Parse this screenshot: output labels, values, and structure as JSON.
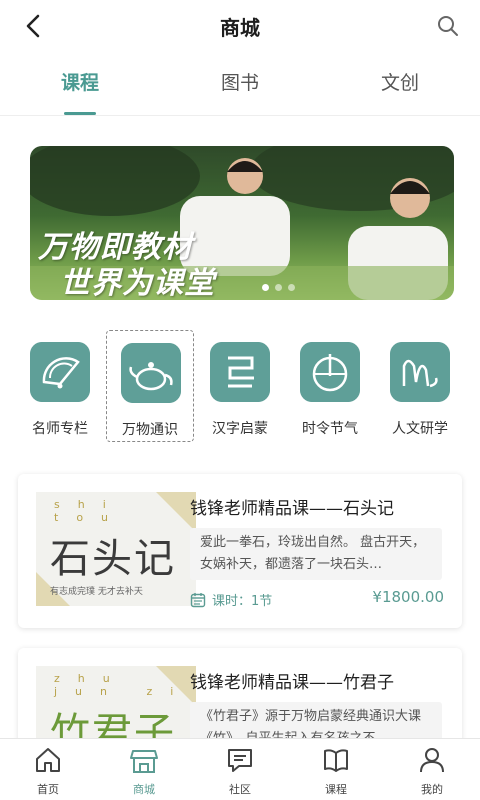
{
  "header": {
    "title": "商城",
    "back_icon": "back-arrow-icon",
    "search_icon": "search-icon"
  },
  "tabs": [
    {
      "label": "课程",
      "active": true
    },
    {
      "label": "图书",
      "active": false
    },
    {
      "label": "文创",
      "active": false
    }
  ],
  "banner": {
    "line1": "万物即教材",
    "line2": "世界为课堂",
    "slide_count": 3,
    "active_slide": 0
  },
  "categories": [
    {
      "label": "名师专栏",
      "icon": "fan-icon"
    },
    {
      "label": "万物通识",
      "icon": "teapot-icon"
    },
    {
      "label": "汉字启蒙",
      "icon": "character-icon"
    },
    {
      "label": "时令节气",
      "icon": "sundial-icon"
    },
    {
      "label": "人文研学",
      "icon": "mountain-icon"
    }
  ],
  "courses": [
    {
      "cover_pinyin": "shi  tou",
      "cover_title": "石头记",
      "cover_sub": "有志成完璞  无才去补天",
      "title": "钱锋老师精品课——石头记",
      "desc": "爱此一拳石，玲珑出自然。 盘古开天，女娲补天，都遗落了一块石头…",
      "lessons": "课时：1节",
      "price": "¥1800.00"
    },
    {
      "cover_pinyin": "zhu  jun  zi",
      "cover_title": "竹君子",
      "title": "钱锋老师精品课——竹君子",
      "desc": "《竹君子》源于万物启蒙经典通识大课《竹》，自平生起入有名孩之不"
    }
  ],
  "bottom_nav": [
    {
      "label": "首页",
      "icon": "home-icon",
      "active": false
    },
    {
      "label": "商城",
      "icon": "store-icon",
      "active": true
    },
    {
      "label": "社区",
      "icon": "chat-icon",
      "active": false
    },
    {
      "label": "课程",
      "icon": "book-icon",
      "active": false
    },
    {
      "label": "我的",
      "icon": "user-icon",
      "active": false
    }
  ],
  "colors": {
    "accent": "#5a9b92",
    "icon_bg": "#5f9f98",
    "text": "#222222"
  }
}
